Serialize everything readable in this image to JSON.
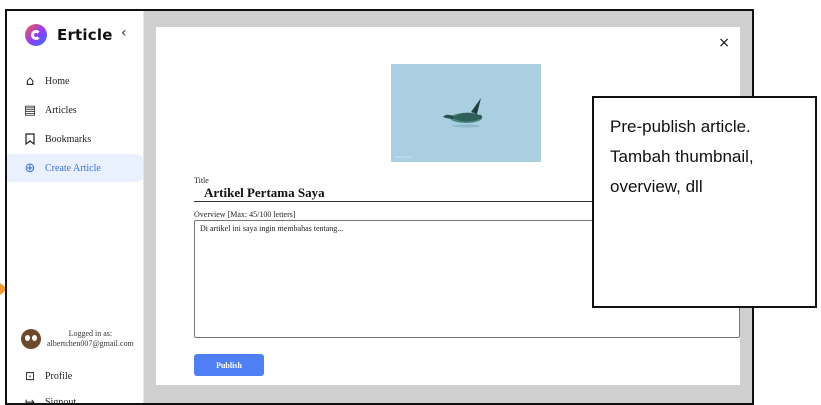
{
  "app": {
    "name": "Erticle",
    "collapse_glyph": "‹"
  },
  "sidebar": {
    "items": [
      {
        "label": "Home",
        "icon": "home-icon"
      },
      {
        "label": "Articles",
        "icon": "article-icon"
      },
      {
        "label": "Bookmarks",
        "icon": "bookmark-icon"
      },
      {
        "label": "Create Article",
        "icon": "plus-circle-icon",
        "active": true
      }
    ],
    "user": {
      "logged_label": "Logged in as:",
      "email": "albertchen007@gmail.com"
    },
    "bottom": [
      {
        "label": "Profile",
        "icon": "profile-icon"
      },
      {
        "label": "Signout",
        "icon": "signout-icon"
      }
    ]
  },
  "modal": {
    "close": "×",
    "thumbnail_caption": "image by xyz",
    "title_label": "Title",
    "title_value": "Artikel Pertama Saya",
    "overview_label": "Overview [Max: 45/100 letters]",
    "overview_value": "Di artikel ini saya ingin membahas tentang...",
    "publish_label": "Publish"
  },
  "annotation": {
    "text": "Pre-publish article. Tambah thumbnail, overview, dll"
  },
  "colors": {
    "accent": "#4f7ff5",
    "active_bg": "#e9f1ff",
    "overlay": "#cfcfcf",
    "arrow": "#f39a2d"
  }
}
